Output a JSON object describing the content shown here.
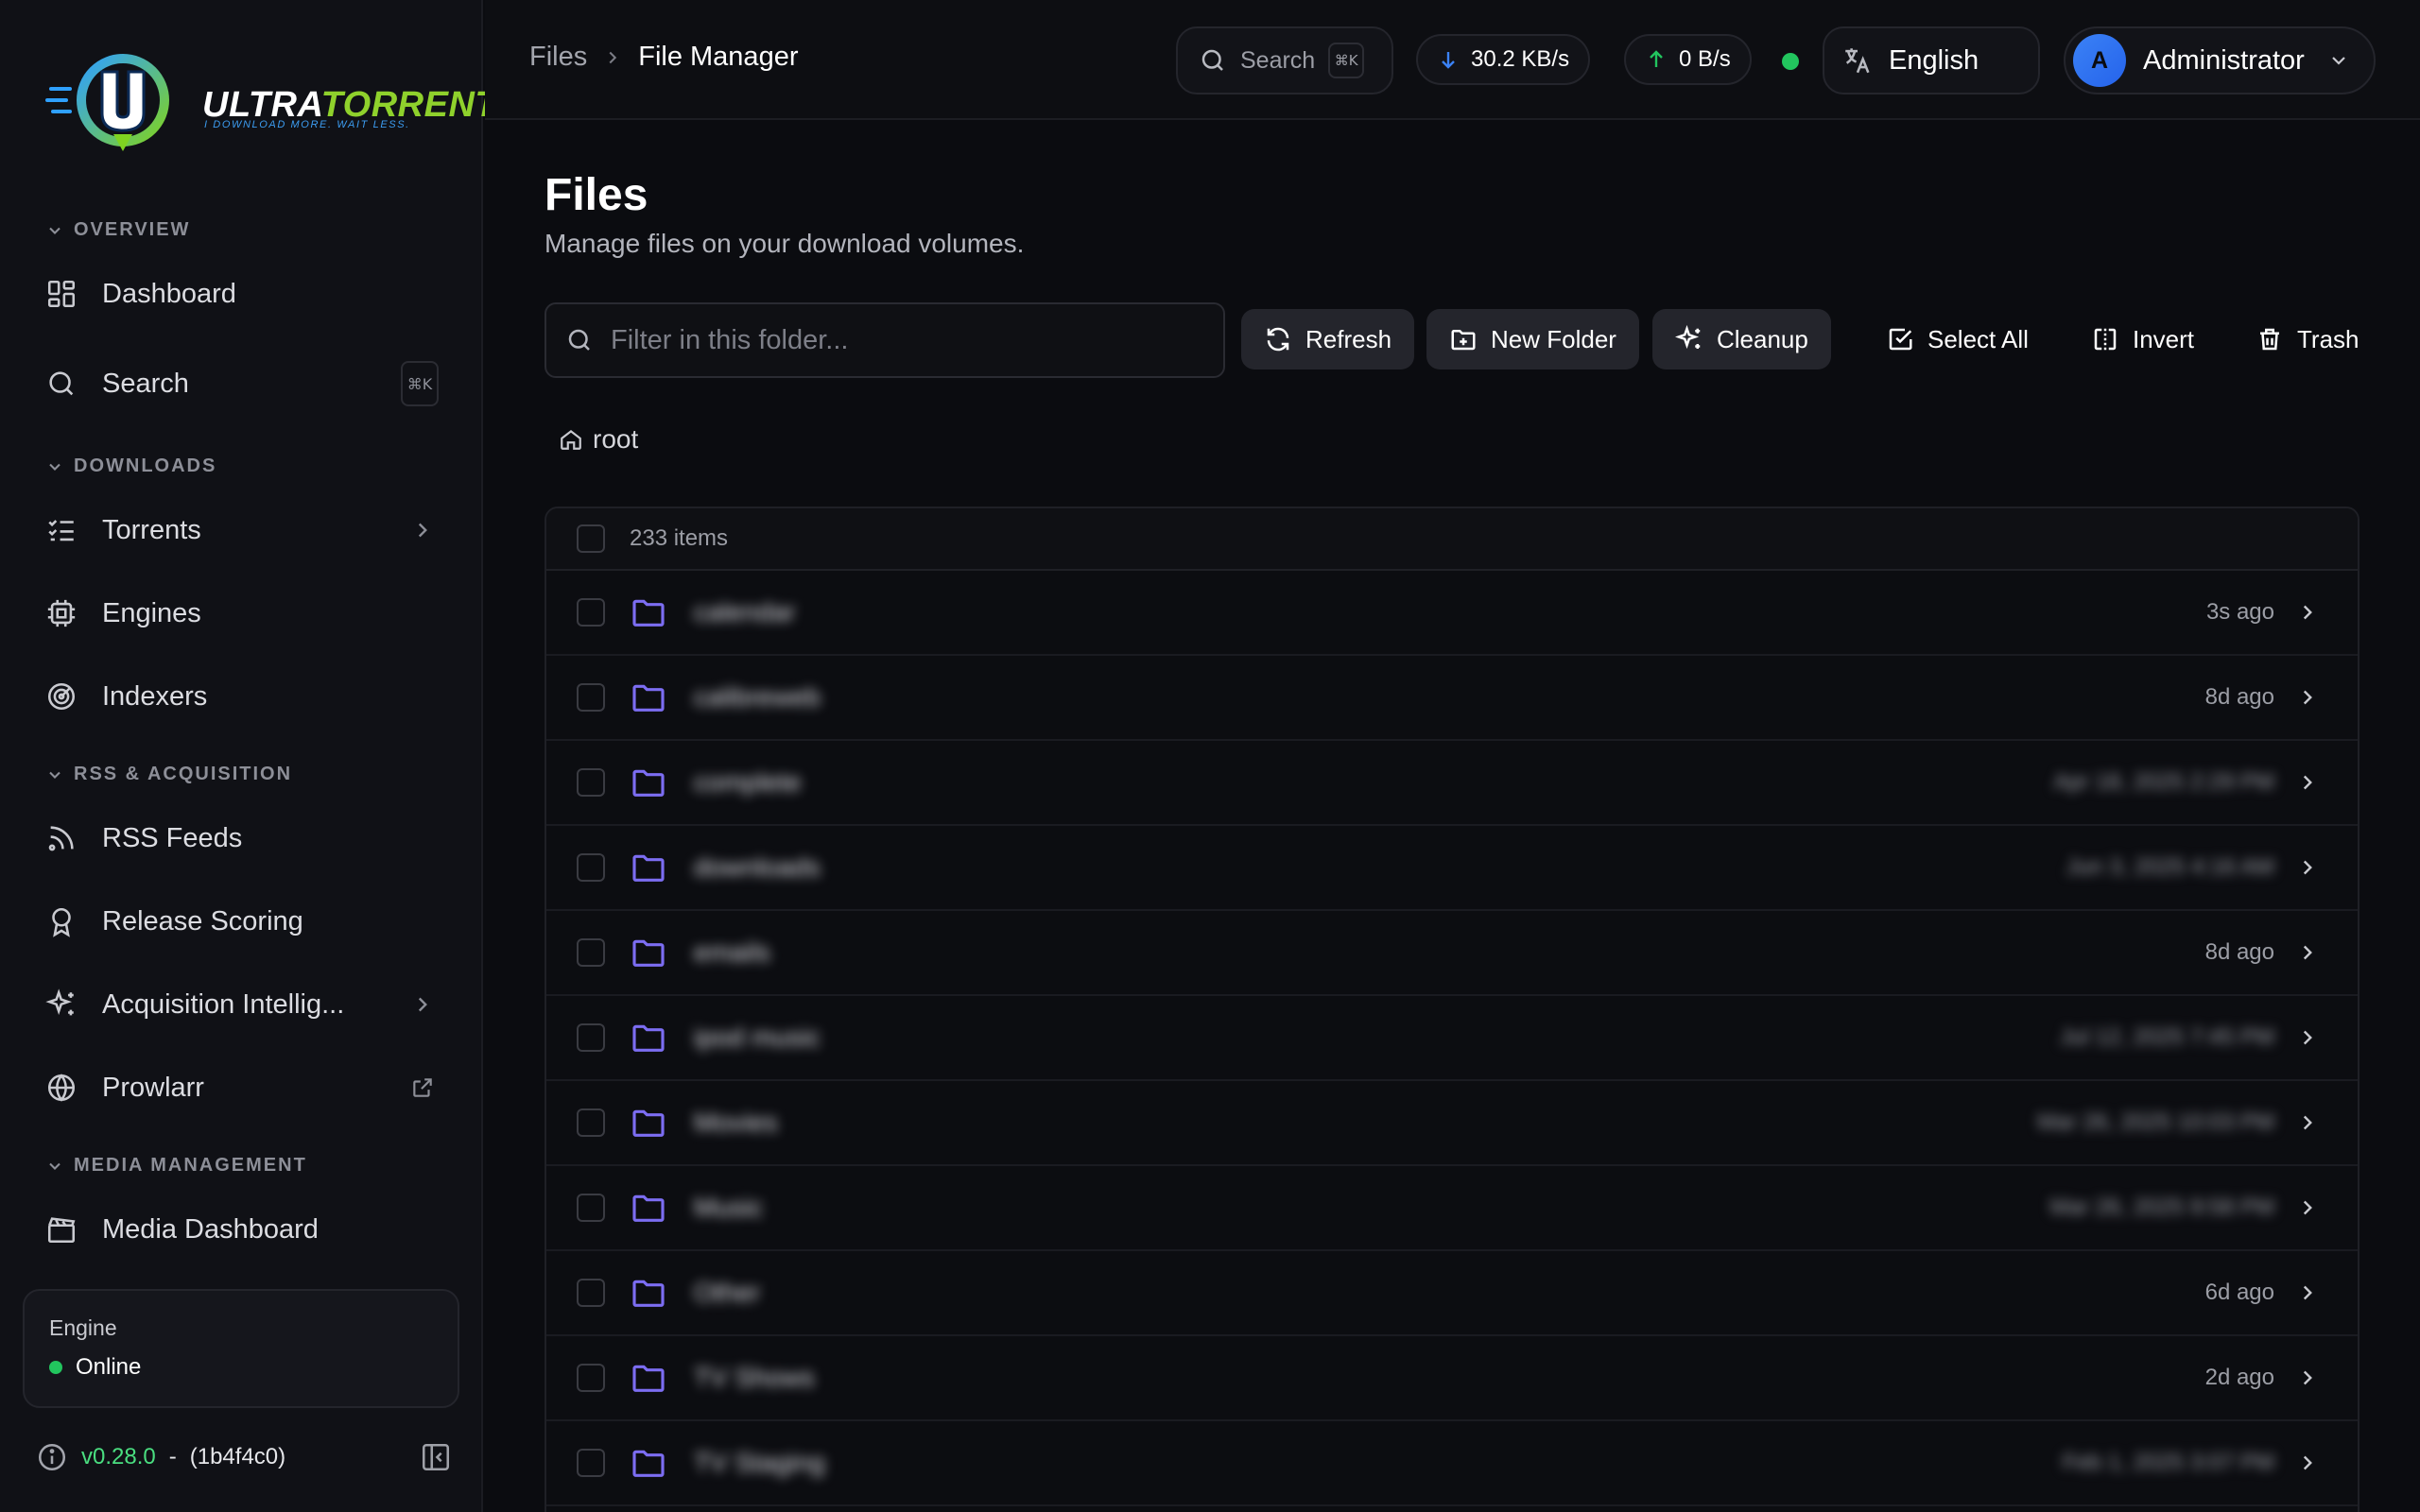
{
  "sidebar": {
    "logo": {
      "wordmark_a": "ULTRA",
      "wordmark_b": "TORRENT",
      "tagline": "I DOWNLOAD MORE. WAIT LESS."
    },
    "sections": {
      "overview": "OVERVIEW",
      "downloads": "DOWNLOADS",
      "rss": "RSS & ACQUISITION",
      "media": "MEDIA MANAGEMENT"
    },
    "items": {
      "dashboard": "Dashboard",
      "search": "Search",
      "search_kbd": "⌘K",
      "torrents": "Torrents",
      "engines": "Engines",
      "indexers": "Indexers",
      "rss_feeds": "RSS Feeds",
      "release_scoring": "Release Scoring",
      "acquisition": "Acquisition Intellig...",
      "prowlarr": "Prowlarr",
      "media_dashboard": "Media Dashboard"
    },
    "engine": {
      "label": "Engine",
      "status": "Online",
      "status_color": "#22c55e"
    },
    "version": {
      "number": "v0.28.0",
      "separator": "-",
      "commit": "(1b4f4c0)"
    }
  },
  "header": {
    "breadcrumb": [
      "Files",
      "File Manager"
    ],
    "search": {
      "label": "Search",
      "kbd": "⌘K"
    },
    "download_rate": "30.2 KB/s",
    "upload_rate": "0 B/s",
    "connection_color": "#22c55e",
    "language": "English",
    "user": {
      "initial": "A",
      "name": "Administrator"
    }
  },
  "main": {
    "title": "Files",
    "subtitle": "Manage files on your download volumes.",
    "filter_placeholder": "Filter in this folder...",
    "toolbar": {
      "refresh": "Refresh",
      "new_folder": "New Folder",
      "cleanup": "Cleanup",
      "select_all": "Select All",
      "invert": "Invert",
      "trash": "Trash"
    },
    "path_root": "root",
    "items_count": "233 items",
    "rows": [
      {
        "name": "calendar",
        "time": "3s ago",
        "time_blurred": false
      },
      {
        "name": "calibreweb",
        "time": "8d ago",
        "time_blurred": false
      },
      {
        "name": "complete",
        "time": "Apr 18, 2025 2:29 PM",
        "time_blurred": true
      },
      {
        "name": "downloads",
        "time": "Jun 3, 2025 4:16 AM",
        "time_blurred": true
      },
      {
        "name": "emails",
        "time": "8d ago",
        "time_blurred": false
      },
      {
        "name": "ipod music",
        "time": "Jul 12, 2025 7:45 PM",
        "time_blurred": true
      },
      {
        "name": "Movies",
        "time": "Mar 26, 2025 10:03 PM",
        "time_blurred": true
      },
      {
        "name": "Music",
        "time": "Mar 26, 2025 9:58 PM",
        "time_blurred": true
      },
      {
        "name": "Other",
        "time": "6d ago",
        "time_blurred": false
      },
      {
        "name": "TV Shows",
        "time": "2d ago",
        "time_blurred": false
      },
      {
        "name": "TV Staging",
        "time": "Feb 1, 2025 3:07 PM",
        "time_blurred": true
      }
    ]
  },
  "colors": {
    "accent_folder": "#7c6df2",
    "online": "#22c55e",
    "download_arrow": "#3b82f6",
    "upload_arrow": "#22c55e"
  }
}
